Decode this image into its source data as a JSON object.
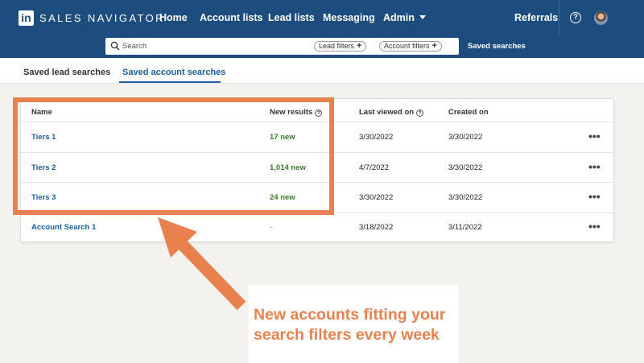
{
  "colors": {
    "nav_bg": "#1d4d7e",
    "link": "#1d5fa0",
    "new_results": "#3b7b2e",
    "annotation": "#e9814e",
    "page_bg": "#f3f2ef"
  },
  "nav": {
    "logo": "in",
    "brand": "SALES NAVIGATOR",
    "items": [
      "Home",
      "Account lists",
      "Lead lists",
      "Messaging",
      "Admin"
    ],
    "referrals": "Referrals",
    "help_glyph": "?",
    "icons": [
      "help-icon",
      "avatar"
    ]
  },
  "search": {
    "placeholder": "Search",
    "lead_filters": "Lead filters",
    "account_filters": "Account filters",
    "saved_searches": "Saved searches"
  },
  "tabs": [
    "Saved lead searches",
    "Saved account searches"
  ],
  "active_tab": 1,
  "table": {
    "headers": [
      "Name",
      "New results",
      "Last viewed on",
      "Created on"
    ],
    "rows": [
      {
        "name": "Tiers 1",
        "new_results": "17 new",
        "last_viewed": "3/30/2022",
        "created": "3/30/2022",
        "more": "•••"
      },
      {
        "name": "Tiers 2",
        "new_results": "1,014 new",
        "last_viewed": "4/7/2022",
        "created": "3/30/2022",
        "more": "•••"
      },
      {
        "name": "Tiers 3",
        "new_results": "24 new",
        "last_viewed": "3/30/2022",
        "created": "3/30/2022",
        "more": "•••"
      },
      {
        "name": "Account Search 1",
        "new_results": "-",
        "last_viewed": "3/18/2022",
        "created": "3/11/2022",
        "more": "•••"
      }
    ]
  },
  "annotation": {
    "callout_line1": "New accounts fitting your",
    "callout_line2": "search filters every week"
  }
}
